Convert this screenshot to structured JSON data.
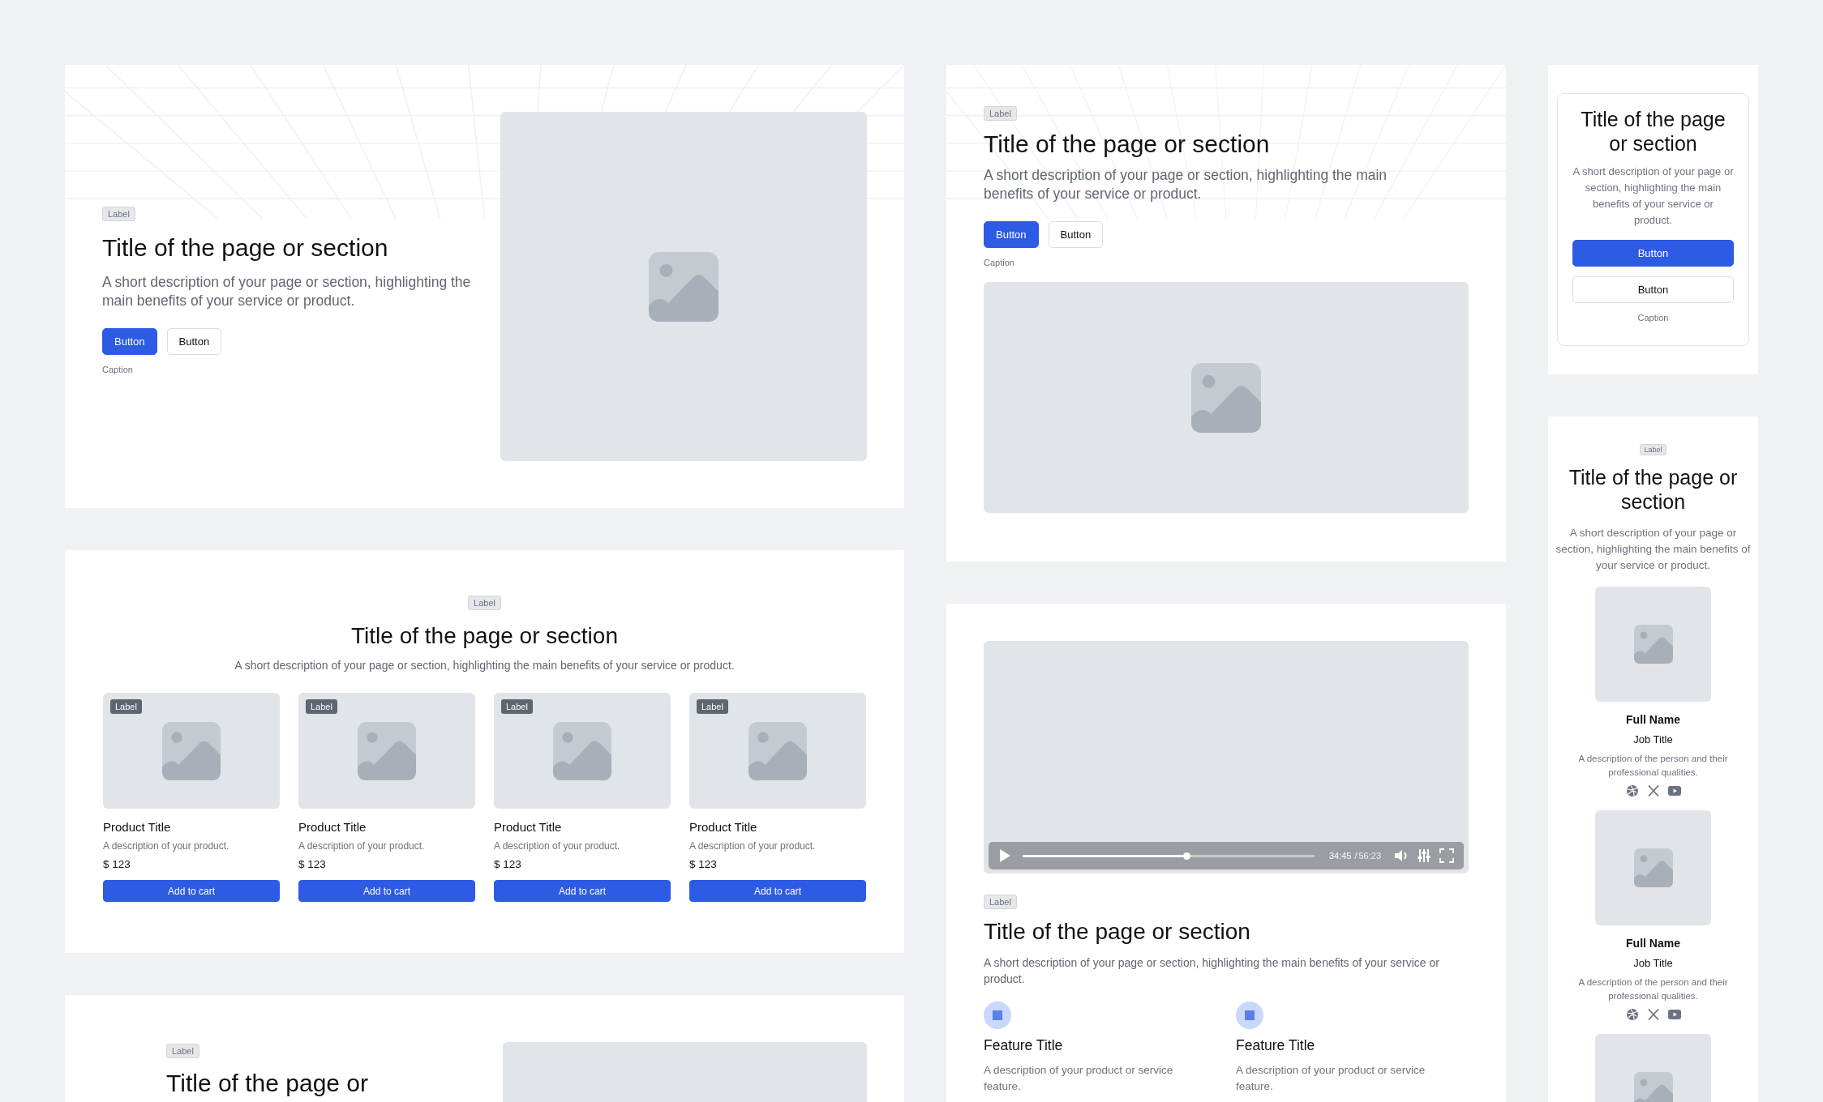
{
  "hero_split": {
    "label": "Label",
    "title": "Title of the page or section",
    "description": "A short description of your page or section, highlighting the main benefits of your service or product.",
    "buttons": [
      {
        "label": "Button",
        "kind": "primary"
      },
      {
        "label": "Button",
        "kind": "secondary"
      }
    ],
    "caption": "Caption"
  },
  "products_section": {
    "label": "Label",
    "title": "Title of the page or section",
    "description": "A short description of your page or section, highlighting the main benefits of your service or product.",
    "products": [
      {
        "badge": "Label",
        "title": "Product Title",
        "description": "A description of your product.",
        "price": "$ 123",
        "button": "Add to cart"
      },
      {
        "badge": "Label",
        "title": "Product Title",
        "description": "A description of your product.",
        "price": "$ 123",
        "button": "Add to cart"
      },
      {
        "badge": "Label",
        "title": "Product Title",
        "description": "A description of your product.",
        "price": "$ 123",
        "button": "Add to cart"
      },
      {
        "badge": "Label",
        "title": "Product Title",
        "description": "A description of your product.",
        "price": "$ 123",
        "button": "Add to cart"
      }
    ]
  },
  "split_section": {
    "label": "Label",
    "title": "Title of the page or"
  },
  "hero_stacked": {
    "label": "Label",
    "title": "Title of the page or section",
    "description": "A short description of your page or section, highlighting the main benefits of your service or product.",
    "buttons": [
      {
        "label": "Button",
        "kind": "primary"
      },
      {
        "label": "Button",
        "kind": "secondary"
      }
    ],
    "caption": "Caption"
  },
  "video_section": {
    "player": {
      "level": 0.56,
      "elapsed": "34:45",
      "separator": "/",
      "total": "56:23"
    },
    "label": "Label",
    "title": "Title of the page or section",
    "description": "A short description of your page or section, highlighting the main benefits of your service or product.",
    "features": [
      {
        "title": "Feature Title",
        "description": "A description of your product or service feature."
      },
      {
        "title": "Feature Title",
        "description": "A description of your product or service feature."
      }
    ]
  },
  "hero_card": {
    "title": "Title of the page or section",
    "description": "A short description of your page or section, highlighting the main benefits of your service or product.",
    "buttons": [
      {
        "label": "Button",
        "kind": "primary"
      },
      {
        "label": "Button",
        "kind": "secondary"
      }
    ],
    "caption": "Caption"
  },
  "team_section": {
    "label": "Label",
    "title": "Title of the page or section",
    "description": "A short description of your page or section, highlighting the main benefits of your service or product.",
    "members": [
      {
        "kind": "person",
        "name": "Full Name",
        "job_title": "Job Title",
        "description": "A description of the person and their professional qualities."
      },
      {
        "kind": "person",
        "name": "Full Name",
        "job_title": "Job Title",
        "description": "A description of the person and their professional qualities."
      },
      {
        "kind": "picture"
      }
    ]
  }
}
